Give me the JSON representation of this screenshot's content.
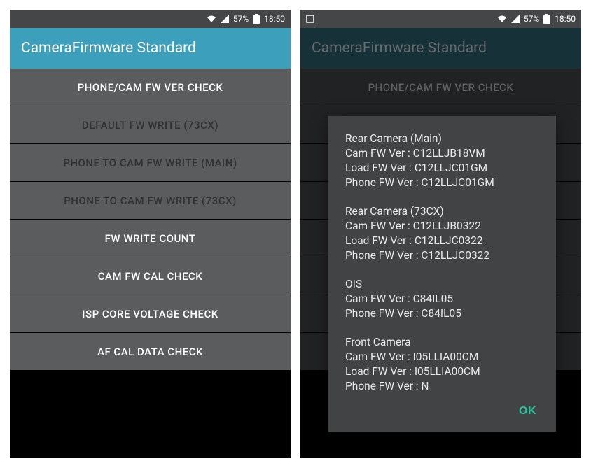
{
  "status": {
    "battery_pct": "57%",
    "time": "18:50"
  },
  "appbar": {
    "title": "CameraFirmware Standard"
  },
  "menu": [
    {
      "label": "PHONE/CAM FW VER CHECK",
      "enabled": true,
      "key": "fw-ver-check"
    },
    {
      "label": "DEFAULT FW WRITE (73CX)",
      "enabled": false,
      "key": "default-fw-write"
    },
    {
      "label": "PHONE TO CAM FW WRITE (MAIN)",
      "enabled": false,
      "key": "p2c-main"
    },
    {
      "label": "PHONE TO CAM FW WRITE (73CX)",
      "enabled": false,
      "key": "p2c-73cx"
    },
    {
      "label": "FW WRITE COUNT",
      "enabled": true,
      "key": "fw-write-count"
    },
    {
      "label": "CAM FW CAL CHECK",
      "enabled": true,
      "key": "cam-cal-check"
    },
    {
      "label": "ISP CORE VOLTAGE CHECK",
      "enabled": true,
      "key": "isp-voltage"
    },
    {
      "label": "AF CAL DATA CHECK",
      "enabled": true,
      "key": "af-cal"
    }
  ],
  "dialog": {
    "ok": "OK",
    "sections": [
      {
        "title": "Rear Camera (Main)",
        "lines": [
          "Cam FW Ver : C12LLJB18VM",
          "Load FW Ver : C12LLJC01GM",
          "Phone FW Ver : C12LLJC01GM"
        ]
      },
      {
        "title": "Rear Camera (73CX)",
        "lines": [
          "Cam FW Ver : C12LLJB0322",
          "Load FW Ver : C12LLJC0322",
          "Phone FW Ver : C12LLJC0322"
        ]
      },
      {
        "title": "OIS",
        "lines": [
          "Cam FW Ver : C84IL05",
          "Phone FW Ver : C84IL05"
        ]
      },
      {
        "title": "Front Camera",
        "lines": [
          "Cam FW Ver : I05LLIA00CM",
          "Load FW Ver : I05LLIA00CM",
          "Phone FW Ver : N"
        ]
      }
    ]
  }
}
